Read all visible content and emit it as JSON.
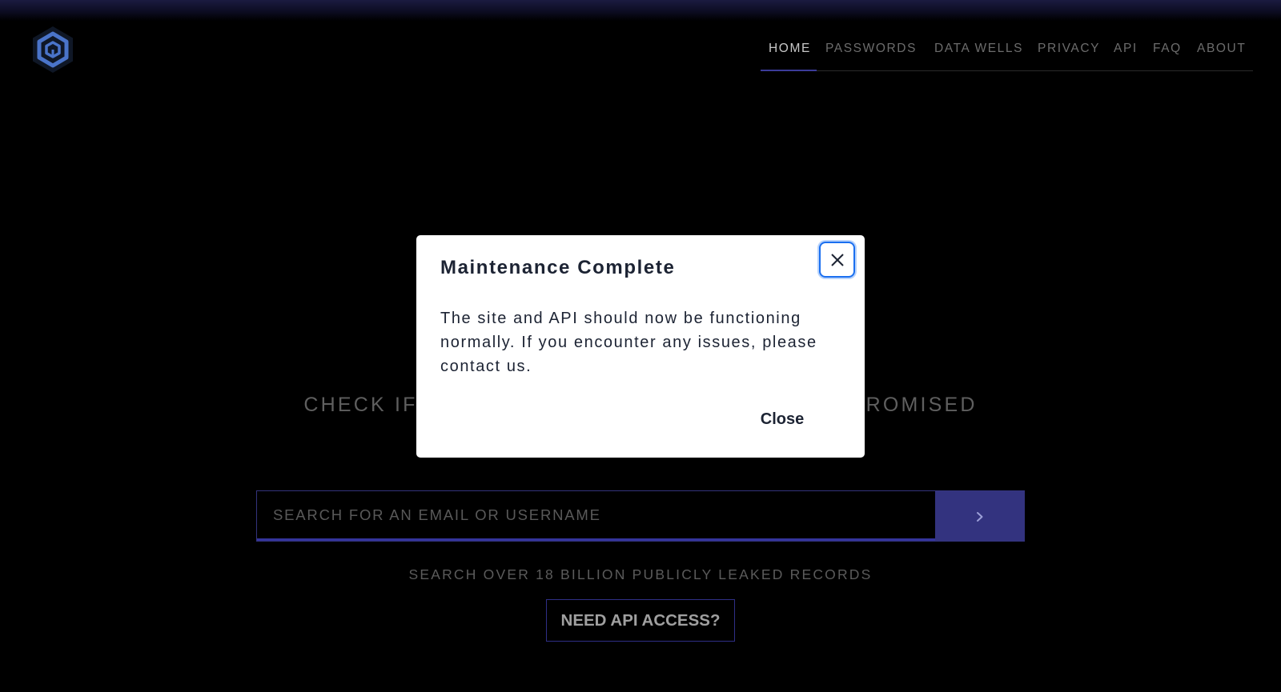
{
  "brand": {
    "logo_icon": "hexagon-cube-logo",
    "accent_color": "#33337f"
  },
  "nav": {
    "items": [
      {
        "label": "HOME",
        "active": true
      },
      {
        "label": "PASSWORDS",
        "active": false
      },
      {
        "label": "DATA WELLS",
        "active": false
      },
      {
        "label": "PRIVACY",
        "active": false
      },
      {
        "label": "API",
        "active": false
      },
      {
        "label": "FAQ",
        "active": false
      },
      {
        "label": "ABOUT",
        "active": false
      }
    ]
  },
  "hero": {
    "title_left": "CHECK IF",
    "title_right": "ROMISED"
  },
  "search": {
    "placeholder": "SEARCH FOR AN EMAIL OR USERNAME",
    "value": "",
    "submit_icon": "chevron-right-icon"
  },
  "subtitle": "SEARCH OVER 18 BILLION PUBLICLY LEAKED RECORDS",
  "api_button": {
    "label": "NEED API ACCESS?"
  },
  "modal": {
    "title": "Maintenance Complete",
    "body": "The site and API should now be functioning normally. If you encounter any issues, please contact us.",
    "close_label": "Close",
    "close_icon": "close-icon"
  }
}
